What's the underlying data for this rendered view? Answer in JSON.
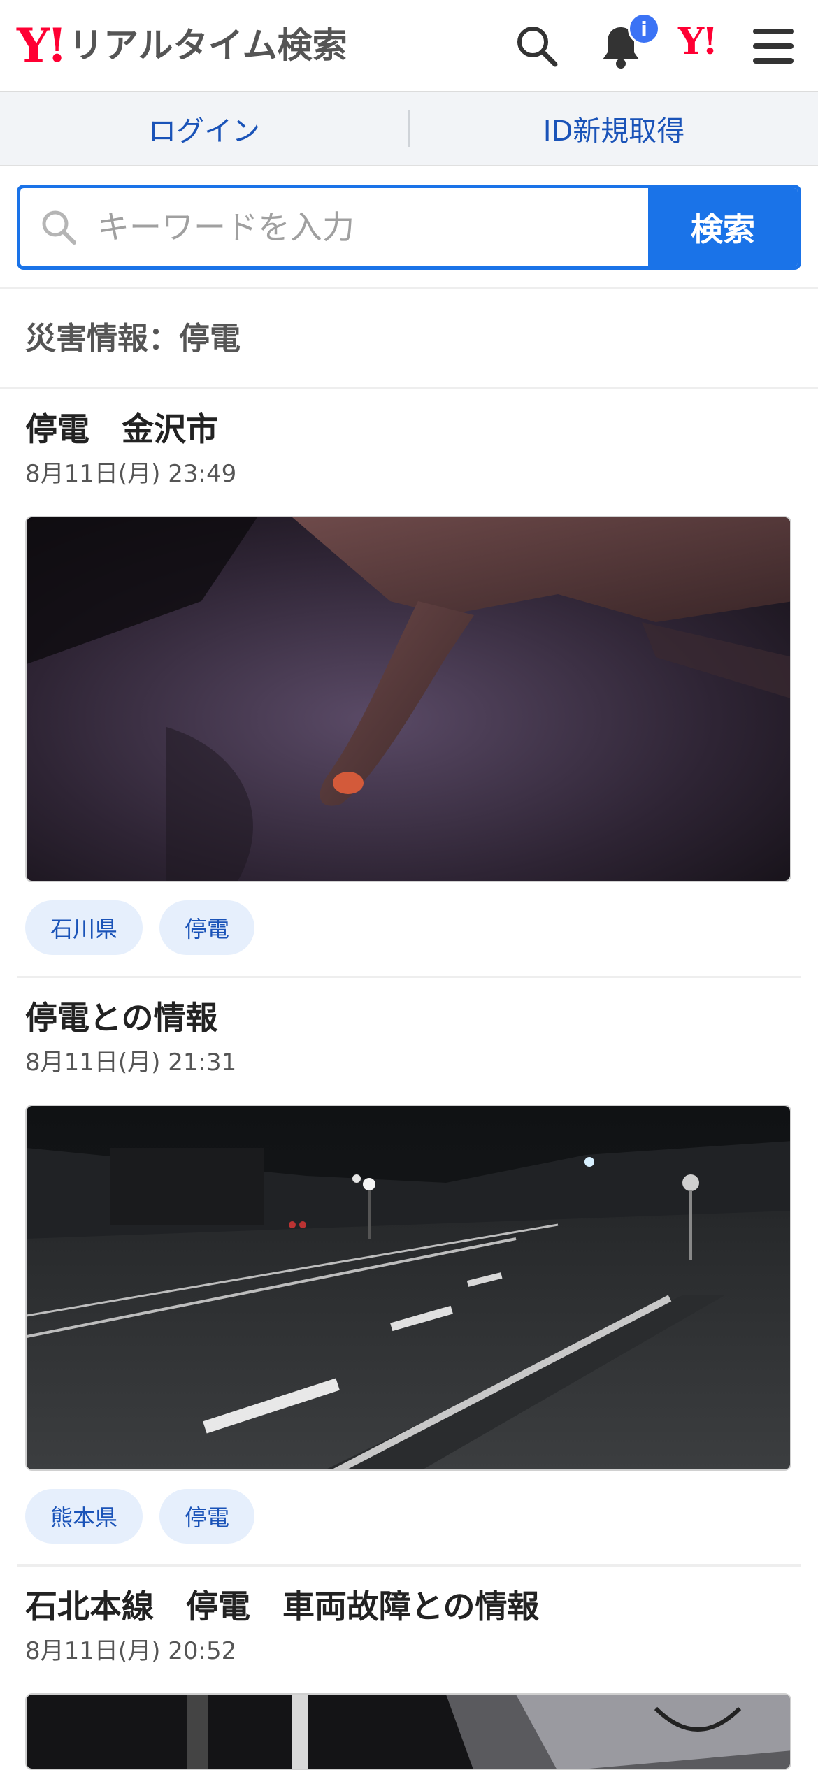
{
  "header": {
    "logo_mark": "Y!",
    "logo_text": "リアルタイム検索",
    "notification_badge": "i",
    "yjapan_mark": "Y!"
  },
  "account": {
    "login_label": "ログイン",
    "signup_label": "ID新規取得"
  },
  "search": {
    "placeholder": "キーワードを入力",
    "button_label": "検索"
  },
  "section": {
    "title": "災害情報：停電"
  },
  "articles": [
    {
      "title": "停電　金沢市",
      "time": "8月11日(月) 23:49",
      "tags": [
        "石川県",
        "停電"
      ]
    },
    {
      "title": "停電との情報",
      "time": "8月11日(月) 21:31",
      "tags": [
        "熊本県",
        "停電"
      ]
    },
    {
      "title": "石北本線　停電　車両故障との情報",
      "time": "8月11日(月) 20:52",
      "tags": []
    }
  ],
  "colors": {
    "brand_red": "#ff0033",
    "accent_blue": "#1a73e8",
    "link_blue": "#1a53b8",
    "tag_bg": "#e6effc"
  }
}
